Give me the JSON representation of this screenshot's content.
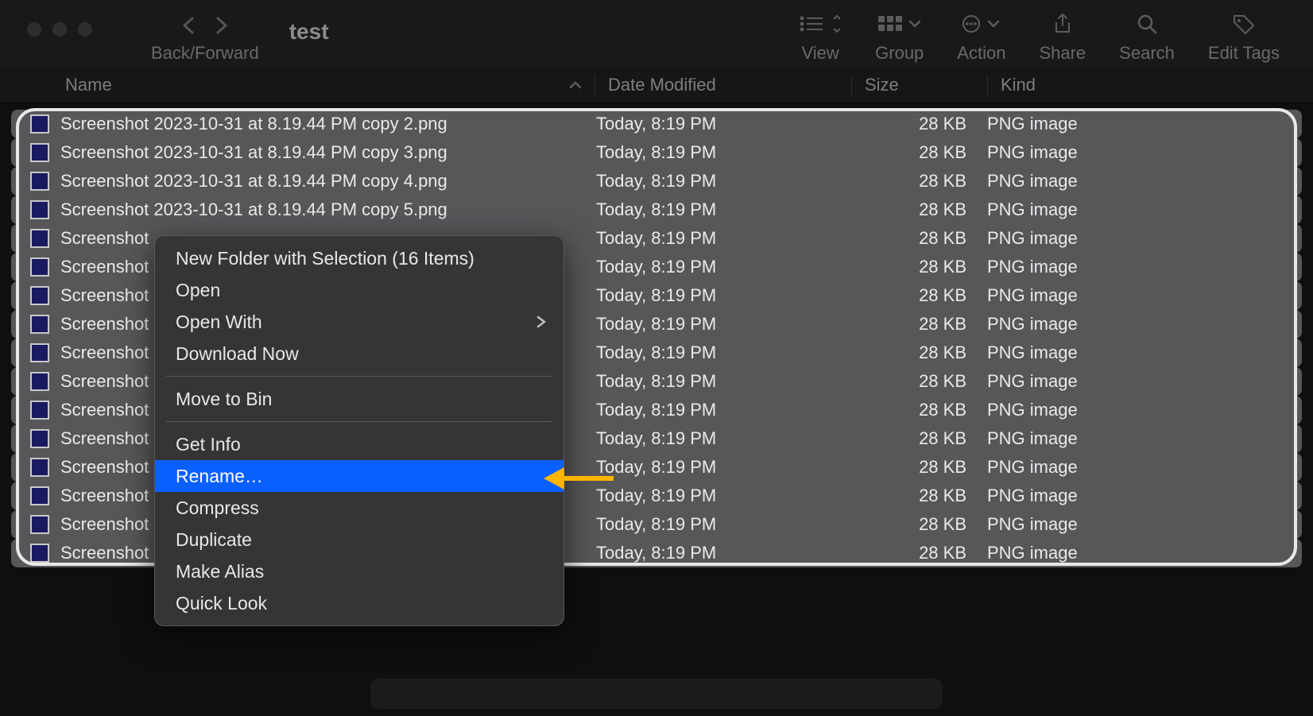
{
  "window": {
    "title": "test"
  },
  "toolbar": {
    "back_forward_label": "Back/Forward",
    "items": [
      {
        "key": "view",
        "label": "View"
      },
      {
        "key": "group",
        "label": "Group"
      },
      {
        "key": "action",
        "label": "Action"
      },
      {
        "key": "share",
        "label": "Share"
      },
      {
        "key": "search",
        "label": "Search"
      },
      {
        "key": "edit_tags",
        "label": "Edit Tags"
      }
    ]
  },
  "columns": {
    "name": "Name",
    "date_modified": "Date Modified",
    "size": "Size",
    "kind": "Kind"
  },
  "files": [
    {
      "name": "Screenshot 2023-10-31 at 8.19.44 PM copy 2.png",
      "date": "Today, 8:19 PM",
      "size": "28 KB",
      "kind": "PNG image"
    },
    {
      "name": "Screenshot 2023-10-31 at 8.19.44 PM copy 3.png",
      "date": "Today, 8:19 PM",
      "size": "28 KB",
      "kind": "PNG image"
    },
    {
      "name": "Screenshot 2023-10-31 at 8.19.44 PM copy 4.png",
      "date": "Today, 8:19 PM",
      "size": "28 KB",
      "kind": "PNG image"
    },
    {
      "name": "Screenshot 2023-10-31 at 8.19.44 PM copy 5.png",
      "date": "Today, 8:19 PM",
      "size": "28 KB",
      "kind": "PNG image"
    },
    {
      "name": "Screenshot",
      "date": "Today, 8:19 PM",
      "size": "28 KB",
      "kind": "PNG image"
    },
    {
      "name": "Screenshot",
      "date": "Today, 8:19 PM",
      "size": "28 KB",
      "kind": "PNG image"
    },
    {
      "name": "Screenshot",
      "date": "Today, 8:19 PM",
      "size": "28 KB",
      "kind": "PNG image"
    },
    {
      "name": "Screenshot",
      "date": "Today, 8:19 PM",
      "size": "28 KB",
      "kind": "PNG image"
    },
    {
      "name": "Screenshot",
      "date": "Today, 8:19 PM",
      "size": "28 KB",
      "kind": "PNG image"
    },
    {
      "name": "Screenshot",
      "date": "Today, 8:19 PM",
      "size": "28 KB",
      "kind": "PNG image"
    },
    {
      "name": "Screenshot",
      "date": "Today, 8:19 PM",
      "size": "28 KB",
      "kind": "PNG image"
    },
    {
      "name": "Screenshot",
      "date": "Today, 8:19 PM",
      "size": "28 KB",
      "kind": "PNG image"
    },
    {
      "name": "Screenshot",
      "date": "Today, 8:19 PM",
      "size": "28 KB",
      "kind": "PNG image"
    },
    {
      "name": "Screenshot",
      "date": "Today, 8:19 PM",
      "size": "28 KB",
      "kind": "PNG image"
    },
    {
      "name": "Screenshot",
      "date": "Today, 8:19 PM",
      "size": "28 KB",
      "kind": "PNG image"
    },
    {
      "name": "Screenshot",
      "date": "Today, 8:19 PM",
      "size": "28 KB",
      "kind": "PNG image"
    }
  ],
  "context_menu": {
    "items": [
      {
        "label": "New Folder with Selection (16 Items)",
        "type": "item"
      },
      {
        "label": "Open",
        "type": "item"
      },
      {
        "label": "Open With",
        "type": "submenu"
      },
      {
        "label": "Download Now",
        "type": "item"
      },
      {
        "type": "separator"
      },
      {
        "label": "Move to Bin",
        "type": "item"
      },
      {
        "type": "separator"
      },
      {
        "label": "Get Info",
        "type": "item"
      },
      {
        "label": "Rename…",
        "type": "item",
        "highlighted": true
      },
      {
        "label": "Compress",
        "type": "item"
      },
      {
        "label": "Duplicate",
        "type": "item"
      },
      {
        "label": "Make Alias",
        "type": "item"
      },
      {
        "label": "Quick Look",
        "type": "item"
      }
    ]
  }
}
